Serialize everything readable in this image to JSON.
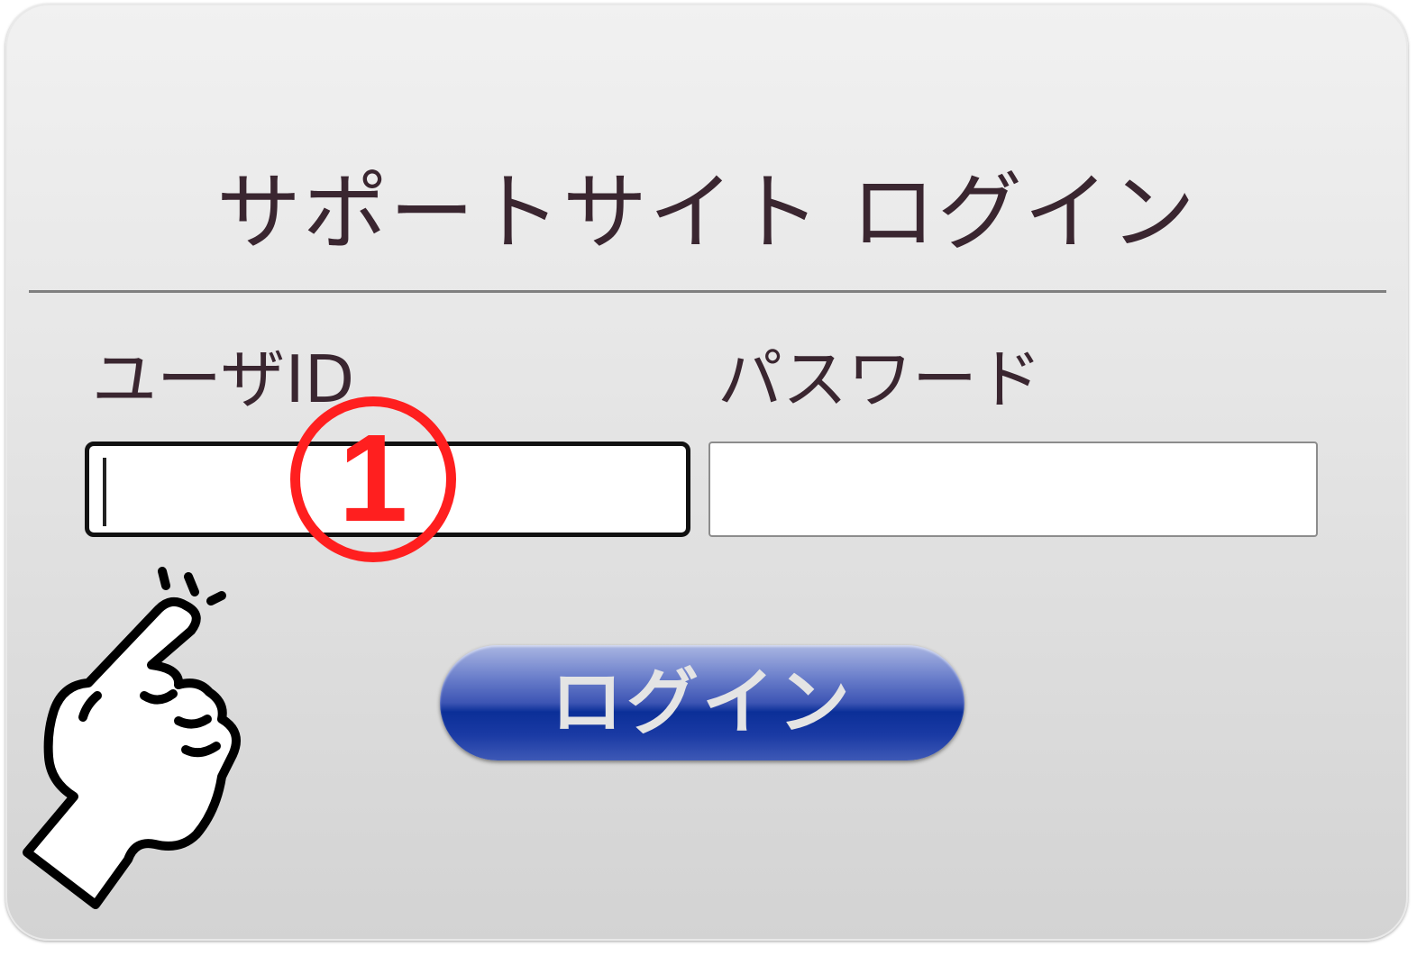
{
  "login_form": {
    "title": "サポートサイト ログイン",
    "user_id_label": "ユーザID",
    "user_id_value": "",
    "password_label": "パスワード",
    "password_value": "",
    "login_button_label": "ログイン"
  },
  "annotation": {
    "step_number": "1",
    "step_color": "#ff1f1f",
    "pointer_icon": "pointing-hand-icon"
  },
  "colors": {
    "text": "#3a2630",
    "button_blue": "#0b2f98",
    "button_text": "#e4e4e4"
  }
}
